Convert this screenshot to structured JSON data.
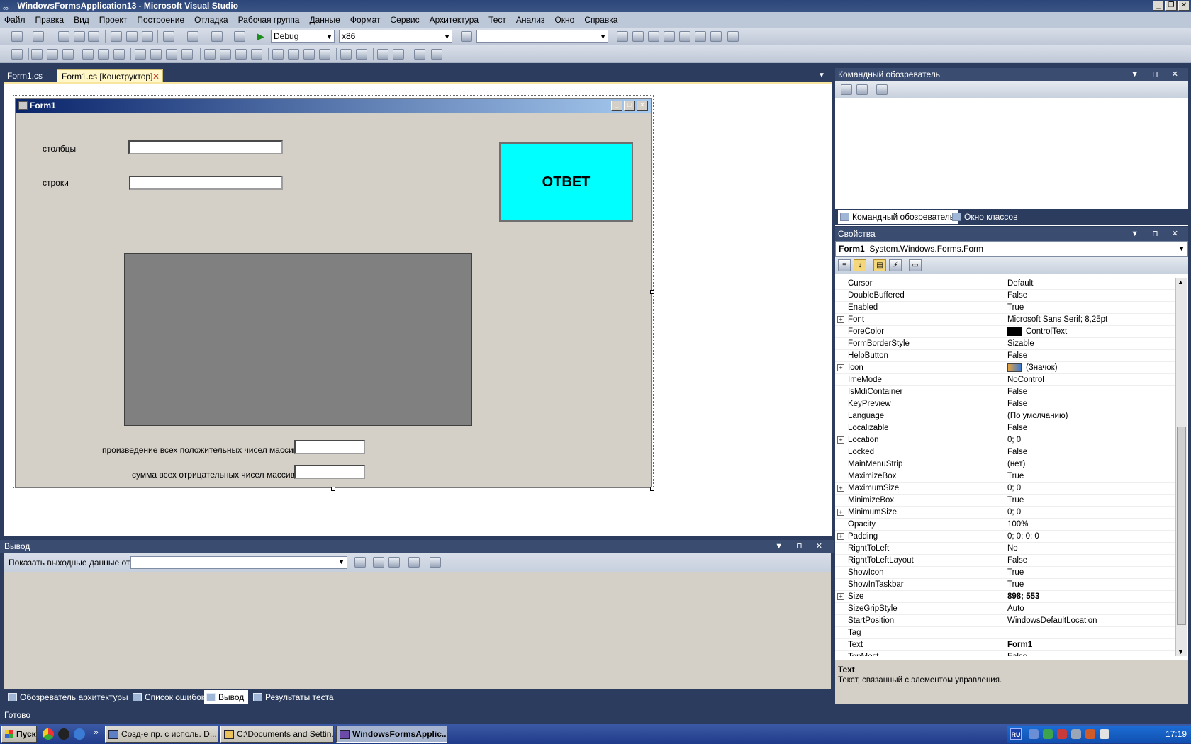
{
  "window": {
    "title": "WindowsFormsApplication13 - Microsoft Visual Studio",
    "controls": [
      "_",
      "❐",
      "✕"
    ]
  },
  "menu": [
    "Файл",
    "Правка",
    "Вид",
    "Проект",
    "Построение",
    "Отладка",
    "Рабочая группа",
    "Данные",
    "Формат",
    "Сервис",
    "Архитектура",
    "Тест",
    "Анализ",
    "Окно",
    "Справка"
  ],
  "toolbar": {
    "configuration": "Debug",
    "platform": "x86",
    "find_value": ""
  },
  "doc_tabs": {
    "tab1": "Form1.cs",
    "tab2": "Form1.cs [Конструктор]",
    "close": "✕"
  },
  "form": {
    "title": "Form1",
    "label_columns": "столбцы",
    "label_rows": "строки",
    "input_columns": "",
    "input_rows": "",
    "answer_button": "ОТВЕТ",
    "label_product": "произведение всех положительных чисел массива",
    "label_sum": "сумма всех отрицательных чисел массива",
    "input_product": "",
    "input_sum": ""
  },
  "output": {
    "title": "Вывод",
    "show_from_label": "Показать выходные данные от:",
    "show_from_value": ""
  },
  "bottom_tabs": [
    "Обозреватель архитектуры",
    "Список ошибок",
    "Вывод",
    "Результаты теста"
  ],
  "status": "Готово",
  "team_explorer": {
    "title": "Командный обозреватель",
    "tab1": "Командный обозреватель",
    "tab2": "Окно классов"
  },
  "properties": {
    "title": "Свойства",
    "object_name": "Form1",
    "object_type": "System.Windows.Forms.Form",
    "rows": [
      {
        "name": "Cursor",
        "value": "Default"
      },
      {
        "name": "DoubleBuffered",
        "value": "False"
      },
      {
        "name": "Enabled",
        "value": "True"
      },
      {
        "name": "Font",
        "value": "Microsoft Sans Serif; 8,25pt",
        "expand": "+"
      },
      {
        "name": "ForeColor",
        "value": "ControlText",
        "swatch": "color"
      },
      {
        "name": "FormBorderStyle",
        "value": "Sizable"
      },
      {
        "name": "HelpButton",
        "value": "False"
      },
      {
        "name": "Icon",
        "value": "(Значок)",
        "expand": "+",
        "swatch": "icon"
      },
      {
        "name": "ImeMode",
        "value": "NoControl"
      },
      {
        "name": "IsMdiContainer",
        "value": "False"
      },
      {
        "name": "KeyPreview",
        "value": "False"
      },
      {
        "name": "Language",
        "value": "(По умолчанию)"
      },
      {
        "name": "Localizable",
        "value": "False"
      },
      {
        "name": "Location",
        "value": "0; 0",
        "expand": "+"
      },
      {
        "name": "Locked",
        "value": "False"
      },
      {
        "name": "MainMenuStrip",
        "value": "(нет)"
      },
      {
        "name": "MaximizeBox",
        "value": "True"
      },
      {
        "name": "MaximumSize",
        "value": "0; 0",
        "expand": "+"
      },
      {
        "name": "MinimizeBox",
        "value": "True"
      },
      {
        "name": "MinimumSize",
        "value": "0; 0",
        "expand": "+"
      },
      {
        "name": "Opacity",
        "value": "100%"
      },
      {
        "name": "Padding",
        "value": "0; 0; 0; 0",
        "expand": "+"
      },
      {
        "name": "RightToLeft",
        "value": "No"
      },
      {
        "name": "RightToLeftLayout",
        "value": "False"
      },
      {
        "name": "ShowIcon",
        "value": "True"
      },
      {
        "name": "ShowInTaskbar",
        "value": "True"
      },
      {
        "name": "Size",
        "value": "898; 553",
        "expand": "+",
        "bold": true
      },
      {
        "name": "SizeGripStyle",
        "value": "Auto"
      },
      {
        "name": "StartPosition",
        "value": "WindowsDefaultLocation"
      },
      {
        "name": "Tag",
        "value": ""
      },
      {
        "name": "Text",
        "value": "Form1",
        "bold": true
      },
      {
        "name": "TopMost",
        "value": "False"
      }
    ],
    "desc_title": "Text",
    "desc_text": "Текст, связанный с элементом управления."
  },
  "taskbar": {
    "start": "Пуск",
    "more": "»",
    "tasks": [
      "Созд-е пр. с исполь. D...",
      "C:\\Documents and Settin...",
      "WindowsFormsApplic..."
    ],
    "lang": "RU",
    "clock": "17:19"
  },
  "colors": {
    "answer_button": "#00ffff",
    "grid_area": "#808080",
    "form_back": "#d4d0c8"
  }
}
